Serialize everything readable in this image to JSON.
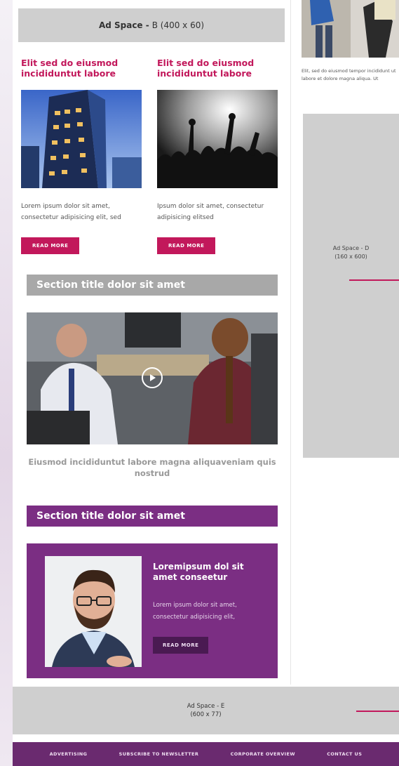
{
  "ad_b": {
    "label": "Ad Space -",
    "dim": "B (400 x 60)"
  },
  "articles": [
    {
      "title": "Elit sed do eiusmod incididuntut labore",
      "text": "Lorem ipsum dolor sit amet, consectetur adipisicing elit, sed",
      "button": "READ MORE"
    },
    {
      "title": "Elit sed do eiusmod incididuntut labore",
      "text": "Ipsum dolor sit amet, consectetur adipisicing elitsed",
      "button": "READ MORE"
    }
  ],
  "section_gray": {
    "title": "Section title dolor sit amet"
  },
  "video": {
    "caption": "Eiusmod incididuntut labore magna aliquaveniam quis nostrud"
  },
  "section_purple": {
    "title": "Section title dolor sit amet"
  },
  "feature": {
    "title": "Loremipsum dol sit amet conseetur",
    "text": "Lorem ipsum dolor sit amet, consectetur adipisicing elit,",
    "button": "READ MORE"
  },
  "side": {
    "text": "Elit, sed do eiusmod tempor incididunt ut labore et dolore magna aliqua. Ut"
  },
  "ad_d": {
    "line1": "Ad Space - D",
    "line2": "(160 x 600)"
  },
  "ad_e": {
    "line1": "Ad Space - E",
    "line2": "(600 x 77)"
  },
  "footer": {
    "items": [
      "ADVERTISING",
      "SUBSCRIBE TO NEWSLETTER",
      "CORPORATE OVERVIEW",
      "CONTACT US"
    ]
  },
  "colors": {
    "accent": "#c2185b",
    "purple": "#7b2e83",
    "footer": "#6a2a6f",
    "ad_gray": "#cfcfcf"
  }
}
